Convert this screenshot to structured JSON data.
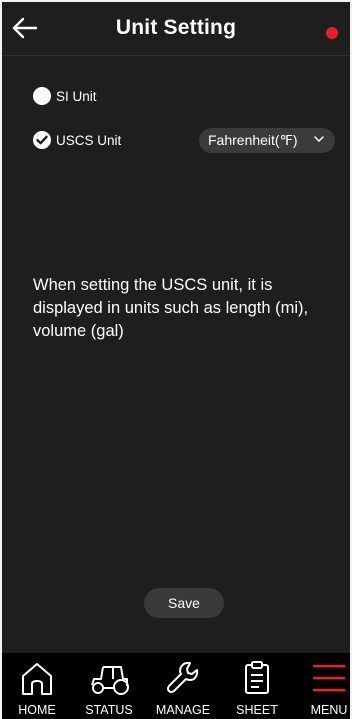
{
  "header": {
    "title": "Unit Setting",
    "back_icon": "arrow-left-icon",
    "status_dot_color": "#e8202a"
  },
  "options": [
    {
      "label": "SI Unit",
      "selected": false
    },
    {
      "label": "USCS Unit",
      "selected": true
    }
  ],
  "temperature_dropdown": {
    "value": "Fahrenheit(℉)"
  },
  "description": "When setting the USCS unit, it is displayed in units such as length (mi), volume (gal)",
  "save_label": "Save",
  "tabs": [
    {
      "label": "HOME",
      "icon": "home-icon"
    },
    {
      "label": "STATUS",
      "icon": "tractor-icon"
    },
    {
      "label": "MANAGE",
      "icon": "wrench-icon"
    },
    {
      "label": "SHEET",
      "icon": "clipboard-icon"
    },
    {
      "label": "MENU",
      "icon": "menu-icon",
      "active": true
    }
  ],
  "colors": {
    "background": "#1e1e1e",
    "accent": "#e8202a",
    "tabbar": "#000000"
  }
}
